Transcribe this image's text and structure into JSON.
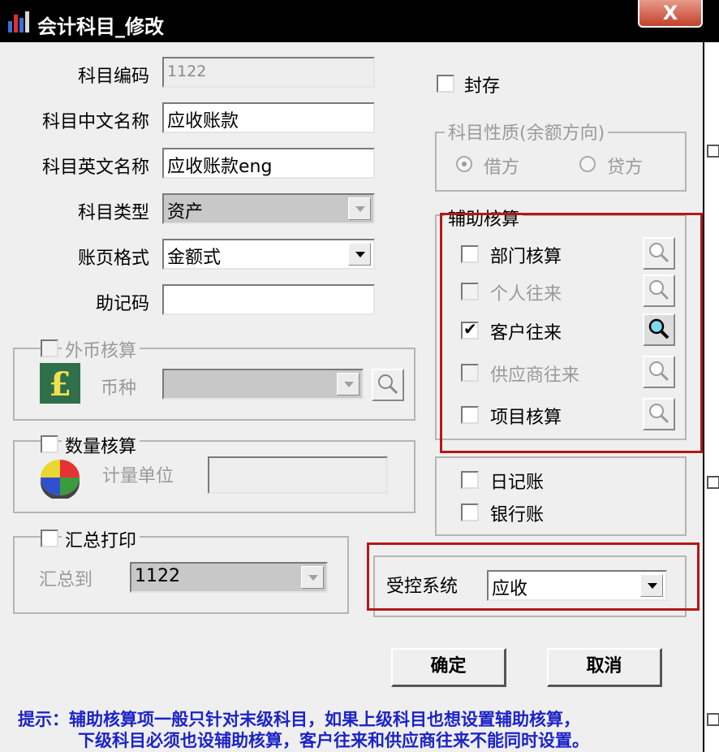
{
  "window": {
    "title": "会计科目_修改",
    "close_label": "X"
  },
  "form": {
    "code": {
      "label": "科目编码",
      "value": "1122"
    },
    "cn_name": {
      "label": "科目中文名称",
      "value": "应收账款"
    },
    "en_name": {
      "label": "科目英文名称",
      "value": "应收账款eng"
    },
    "type": {
      "label": "科目类型",
      "value": "资产"
    },
    "page_format": {
      "label": "账页格式",
      "value": "金额式"
    },
    "mnemonic": {
      "label": "助记码",
      "value": ""
    }
  },
  "sealed": {
    "label": "封存",
    "checked": false
  },
  "nature": {
    "title": "科目性质(余额方向)",
    "debit": "借方",
    "credit": "贷方",
    "selected": "借方"
  },
  "auxiliary": {
    "title": "辅助核算",
    "items": [
      {
        "label": "部门核算",
        "checked": false,
        "enabled": true
      },
      {
        "label": "个人往来",
        "checked": false,
        "enabled": false
      },
      {
        "label": "客户往来",
        "checked": true,
        "enabled": true
      },
      {
        "label": "供应商往来",
        "checked": false,
        "enabled": false
      },
      {
        "label": "项目核算",
        "checked": false,
        "enabled": true
      }
    ]
  },
  "books": {
    "journal": "日记账",
    "bank": "银行账"
  },
  "foreign": {
    "title": "外币核算",
    "currency_label": "币种",
    "currency_value": "",
    "icon_glyph": "£",
    "icon": "pound-icon"
  },
  "quantity": {
    "title": "数量核算",
    "unit_label": "计量单位",
    "unit_value": "",
    "icon": "pie-chart-icon"
  },
  "summary": {
    "title": "汇总打印",
    "to_label": "汇总到",
    "to_value": "1122"
  },
  "controlled": {
    "label": "受控系统",
    "value": "应收"
  },
  "buttons": {
    "ok": "确定",
    "cancel": "取消"
  },
  "hint": {
    "line1": "提示：辅助核算项一般只针对末级科目，如果上级科目也想设置辅助核算，",
    "line2": "下级科目必须也设辅助核算，客户往来和供应商往来不能同时设置。"
  },
  "colors": {
    "hint": "#1c23c8",
    "highlight_box": "#b31818",
    "titlebar": "#000000",
    "close_button": "#c2412c"
  }
}
